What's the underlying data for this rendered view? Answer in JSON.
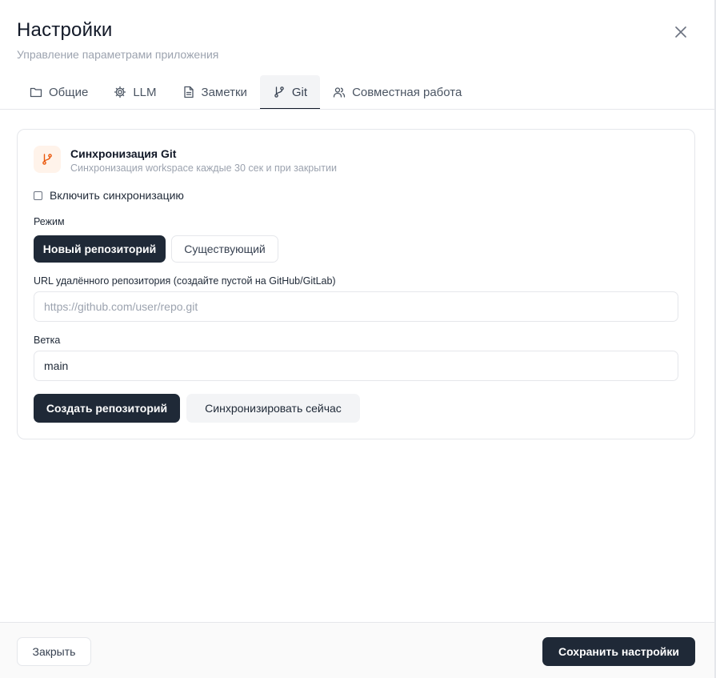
{
  "dialog": {
    "title": "Настройки",
    "subtitle": "Управление параметрами приложения",
    "close_icon": "close-icon"
  },
  "tabs": [
    {
      "label": "Общие",
      "icon": "folder-icon",
      "active": false
    },
    {
      "label": "LLM",
      "icon": "gear-icon",
      "active": false
    },
    {
      "label": "Заметки",
      "icon": "document-icon",
      "active": false
    },
    {
      "label": "Git",
      "icon": "git-branch-icon",
      "active": true
    },
    {
      "label": "Совместная работа",
      "icon": "users-icon",
      "active": false
    }
  ],
  "git_card": {
    "icon": "git-branch-icon",
    "title": "Синхронизация Git",
    "subtitle": "Синхронизация workspace каждые 30 сек и при закрытии",
    "enable_sync_label": "Включить синхронизацию",
    "enable_sync_checked": false,
    "mode_label": "Режим",
    "mode_options": [
      "Новый репозиторий",
      "Существующий"
    ],
    "mode_selected": "Новый репозиторий",
    "url_label": "URL удалённого репозитория (создайте пустой на GitHub/GitLab)",
    "url_value": "",
    "url_placeholder": "https://github.com/user/repo.git",
    "branch_label": "Ветка",
    "branch_value": "main",
    "create_repo_button": "Создать репозиторий",
    "sync_now_button": "Синхронизировать сейчас"
  },
  "footer": {
    "close_button": "Закрыть",
    "save_button": "Сохранить настройки"
  },
  "colors": {
    "primary": "#1f2937",
    "accent_icon": "#ea580c",
    "accent_icon_bg": "#fff3ea",
    "muted_text": "#9ca3af",
    "border": "#e5e7eb"
  }
}
